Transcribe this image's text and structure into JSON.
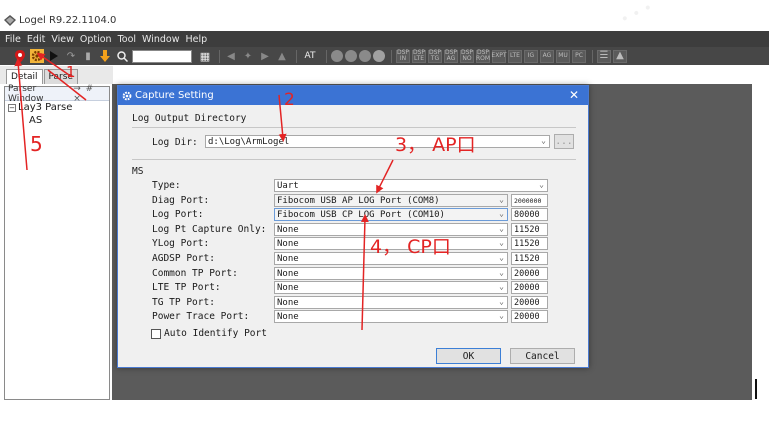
{
  "app": {
    "title": "Logel R9.22.1104.0",
    "menu": [
      "File",
      "Edit",
      "View",
      "Option",
      "Tool",
      "Window",
      "Help"
    ]
  },
  "toolbar": {
    "small_buttons": [
      "DSP IN",
      "DSP LTE",
      "DSP TG",
      "DSP AG",
      "DSP NO",
      "DSP ROM",
      "EXPT",
      "LTE",
      "IG",
      "AG",
      "MU",
      "PC"
    ]
  },
  "tabs": [
    "Detail",
    "Parse"
  ],
  "parser_window": {
    "title": "Parser Window",
    "header_icons": "→ # ×",
    "tree_root": "Lay3 Parse",
    "tree_child": "AS"
  },
  "dialog": {
    "title": "Capture Setting",
    "close": "✕",
    "log_output_group": "Log Output Directory",
    "log_dir_label": "Log Dir:",
    "log_dir_value": "d:\\Log\\ArmLogel",
    "browse_label": "...",
    "ms_group": "MS",
    "rows": [
      {
        "label": "Type:",
        "value": "Uart",
        "baud": ""
      },
      {
        "label": "Diag Port:",
        "value": "Fibocom USB AP LOG Port (COM8)",
        "baud": "2000000"
      },
      {
        "label": "Log Port:",
        "value": "Fibocom USB CP LOG Port (COM10)",
        "baud": "80000"
      },
      {
        "label": "Log Pt Capture Only:",
        "value": "None",
        "baud": "11520"
      },
      {
        "label": "YLog Port:",
        "value": "None",
        "baud": "11520"
      },
      {
        "label": "AGDSP Port:",
        "value": "None",
        "baud": "11520"
      },
      {
        "label": "Common TP Port:",
        "value": "None",
        "baud": "20000"
      },
      {
        "label": "LTE TP Port:",
        "value": "None",
        "baud": "20000"
      },
      {
        "label": "TG TP Port:",
        "value": "None",
        "baud": "20000"
      },
      {
        "label": "Power Trace Port:",
        "value": "None",
        "baud": "20000"
      }
    ],
    "auto_identify_label": "Auto Identify Port",
    "ok_label": "OK",
    "cancel_label": "Cancel"
  },
  "annotations": {
    "n1": "1",
    "n2": "2",
    "n3": "3， AP口",
    "n4": "4， CP口",
    "n5": "5",
    "color": "#e32424"
  },
  "colors": {
    "menubar": "#3d3d3d",
    "toolbar": "#474747",
    "workspace": "#5b5b5b",
    "dialog_title": "#3b73d4"
  }
}
